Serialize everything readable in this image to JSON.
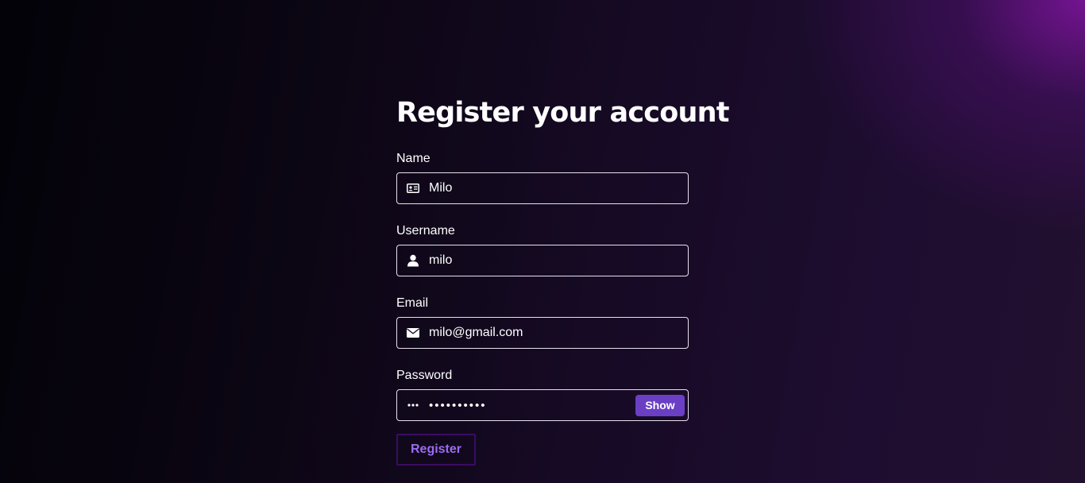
{
  "form": {
    "title": "Register your account",
    "name": {
      "label": "Name",
      "value": "Milo",
      "icon": "id-card-icon"
    },
    "username": {
      "label": "Username",
      "value": "milo",
      "icon": "user-icon"
    },
    "email": {
      "label": "Email",
      "value": "milo@gmail.com",
      "icon": "envelope-icon"
    },
    "password": {
      "label": "Password",
      "value": "••••••••••",
      "icon": "ellipsis-icon",
      "show_label": "Show"
    },
    "register_label": "Register"
  },
  "colors": {
    "accent": "#6a3fc4",
    "register_text": "#9b6cf0",
    "register_border": "#3a0c63",
    "corner_glow": "#7a148f"
  }
}
